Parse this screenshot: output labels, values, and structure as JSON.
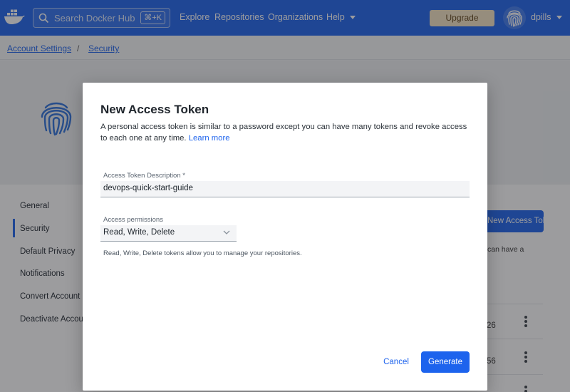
{
  "header": {
    "search_placeholder": "Search Docker Hub",
    "search_shortcut": "⌘+K",
    "nav": [
      "Explore",
      "Repositories",
      "Organizations",
      "Help"
    ],
    "upgrade_label": "Upgrade",
    "username": "dpills"
  },
  "breadcrumb": {
    "items": [
      "Account Settings",
      "Security"
    ],
    "separator": "/"
  },
  "sidebar": {
    "items": [
      "General",
      "Security",
      "Default Privacy",
      "Notifications",
      "Convert Account",
      "Deactivate Account"
    ],
    "active": "Security"
  },
  "background": {
    "new_token_button": "New Access Token",
    "info_text": "can have a",
    "row_values": [
      "26",
      "56"
    ]
  },
  "modal": {
    "title": "New Access Token",
    "description": "A personal access token is similar to a password except you can have many tokens and revoke access to each one at any time.",
    "learn_more": "Learn more",
    "desc_label": "Access Token Description *",
    "desc_value": "devops-quick-start-guide",
    "perm_label": "Access permissions",
    "perm_value": "Read, Write, Delete",
    "perm_help": "Read, Write, Delete tokens allow you to manage your repositories.",
    "cancel_label": "Cancel",
    "generate_label": "Generate"
  },
  "colors": {
    "brand_blue": "#1d63ed",
    "upgrade_bg": "#f4e4c4",
    "overlay": "rgba(35,35,40,0.45)"
  },
  "icons": [
    "docker-whale-icon",
    "search-icon",
    "fingerprint-icon",
    "chevron-down-icon",
    "kebab-menu-icon"
  ]
}
